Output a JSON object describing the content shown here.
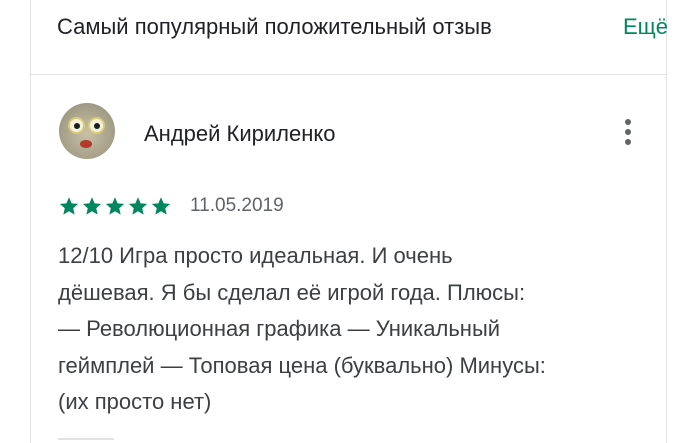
{
  "header": {
    "title": "Самый популярный положительный отзыв",
    "more_label": "Ещё"
  },
  "review": {
    "author": "Андрей Кириленко",
    "rating": 5,
    "rating_max": 5,
    "date": "11.05.2019",
    "text_lines": [
      "12/10 Игра просто идеальная. И очень",
      "дёшевая. Я бы сделал её игрой года. Плюсы:",
      "— Революционная графика — Уникальный",
      "геймплей — Топовая цена (буквально) Минусы:",
      "(их просто нет)"
    ]
  },
  "colors": {
    "accent": "#01875f",
    "title_text": "#202124",
    "body_text": "#3c4043",
    "secondary_text": "#5f6368",
    "divider": "#e3e3e3"
  },
  "icons": {
    "star": "star-icon",
    "menu": "more-vert-icon"
  }
}
